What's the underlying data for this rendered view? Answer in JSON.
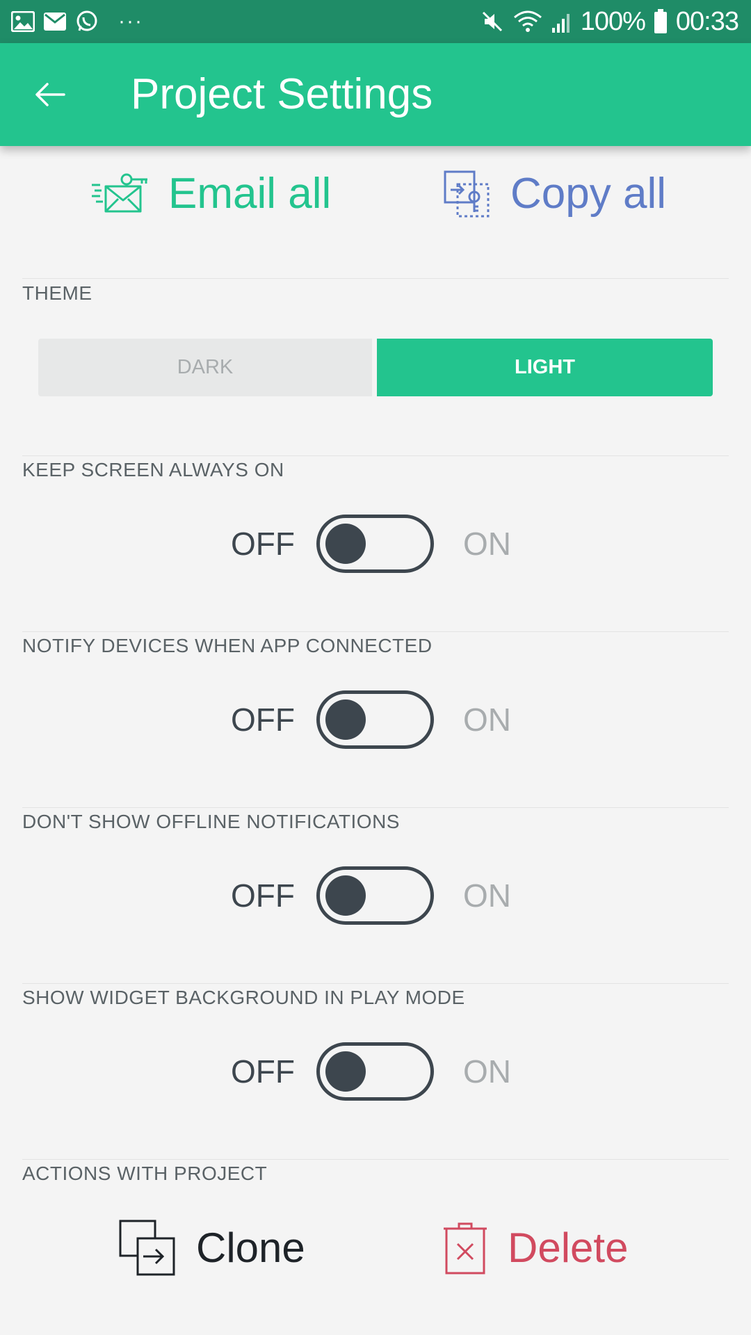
{
  "status_bar": {
    "battery": "100%",
    "time": "00:33",
    "more": "···"
  },
  "app_bar": {
    "title": "Project Settings"
  },
  "top_actions": {
    "email_label": "Email all",
    "copy_label": "Copy all"
  },
  "theme": {
    "label": "THEME",
    "options": [
      "DARK",
      "LIGHT"
    ],
    "selected": "LIGHT"
  },
  "settings": [
    {
      "label": "KEEP SCREEN ALWAYS ON",
      "off": "OFF",
      "on": "ON",
      "state": "off"
    },
    {
      "label": "NOTIFY DEVICES WHEN APP CONNECTED",
      "off": "OFF",
      "on": "ON",
      "state": "off"
    },
    {
      "label": "DON'T SHOW OFFLINE NOTIFICATIONS",
      "off": "OFF",
      "on": "ON",
      "state": "off"
    },
    {
      "label": "SHOW WIDGET BACKGROUND IN PLAY MODE",
      "off": "OFF",
      "on": "ON",
      "state": "off"
    }
  ],
  "project_actions": {
    "label": "ACTIONS WITH PROJECT",
    "clone_label": "Clone",
    "delete_label": "Delete"
  },
  "colors": {
    "accent": "#23c48e",
    "status_bar": "#1f8c67",
    "copy": "#5f7cc7",
    "delete": "#d14a5f",
    "toggle": "#3d464e"
  }
}
